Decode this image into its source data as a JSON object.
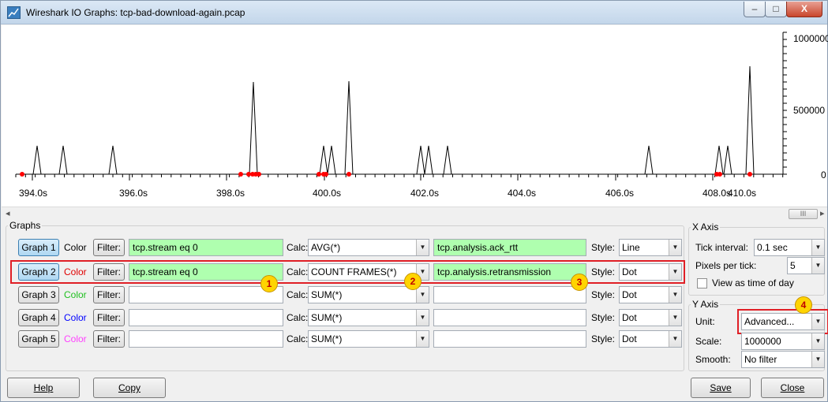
{
  "window": {
    "title": "Wireshark IO Graphs: tcp-bad-download-again.pcap",
    "minimize": "–",
    "maximize": "□",
    "close": "X"
  },
  "graph": {
    "x_ticks": [
      "394.0s",
      "396.0s",
      "398.0s",
      "400.0s",
      "402.0s",
      "404.0s",
      "406.0s",
      "408.0s",
      "410.0s"
    ],
    "y_labels": [
      "1000000",
      "500000",
      "0"
    ],
    "line_color": "#000000",
    "dot_color": "#ff0000",
    "scroll_thumb": "III"
  },
  "graphs_section": {
    "legend": "Graphs",
    "rows": [
      {
        "button": "Graph 1",
        "color_label": "Color",
        "color": "#000000",
        "filter_button": "Filter:",
        "filter": "tcp.stream eq 0",
        "calc_label": "Calc:",
        "calc": "AVG(*)",
        "field": "tcp.analysis.ack_rtt",
        "style_label": "Style:",
        "style": "Line",
        "active": true
      },
      {
        "button": "Graph 2",
        "color_label": "Color",
        "color": "#ff0000",
        "filter_button": "Filter:",
        "filter": "tcp.stream eq 0",
        "calc_label": "Calc:",
        "calc": "COUNT FRAMES(*)",
        "field": "tcp.analysis.retransmission",
        "style_label": "Style:",
        "style": "Dot",
        "active": true
      },
      {
        "button": "Graph 3",
        "color_label": "Color",
        "color": "#00c000",
        "filter_button": "Filter:",
        "filter": "",
        "calc_label": "Calc:",
        "calc": "SUM(*)",
        "field": "",
        "style_label": "Style:",
        "style": "Dot",
        "active": false
      },
      {
        "button": "Graph 4",
        "color_label": "Color",
        "color": "#0000ff",
        "filter_button": "Filter:",
        "filter": "",
        "calc_label": "Calc:",
        "calc": "SUM(*)",
        "field": "",
        "style_label": "Style:",
        "style": "Dot",
        "active": false
      },
      {
        "button": "Graph 5",
        "color_label": "Color",
        "color": "#ff40ff",
        "filter_button": "Filter:",
        "filter": "",
        "calc_label": "Calc:",
        "calc": "SUM(*)",
        "field": "",
        "style_label": "Style:",
        "style": "Dot",
        "active": false
      }
    ]
  },
  "x_axis": {
    "legend": "X Axis",
    "tick_interval_label": "Tick interval:",
    "tick_interval": "0.1 sec",
    "pixels_per_tick_label": "Pixels per tick:",
    "pixels_per_tick": "5",
    "view_as_time_label": "View as time of day"
  },
  "y_axis": {
    "legend": "Y Axis",
    "unit_label": "Unit:",
    "unit": "Advanced...",
    "scale_label": "Scale:",
    "scale": "1000000",
    "smooth_label": "Smooth:",
    "smooth": "No filter"
  },
  "annotations": [
    "1",
    "2",
    "3",
    "4"
  ],
  "bottom_buttons": {
    "help": "Help",
    "copy": "Copy",
    "save": "Save",
    "close": "Close"
  }
}
